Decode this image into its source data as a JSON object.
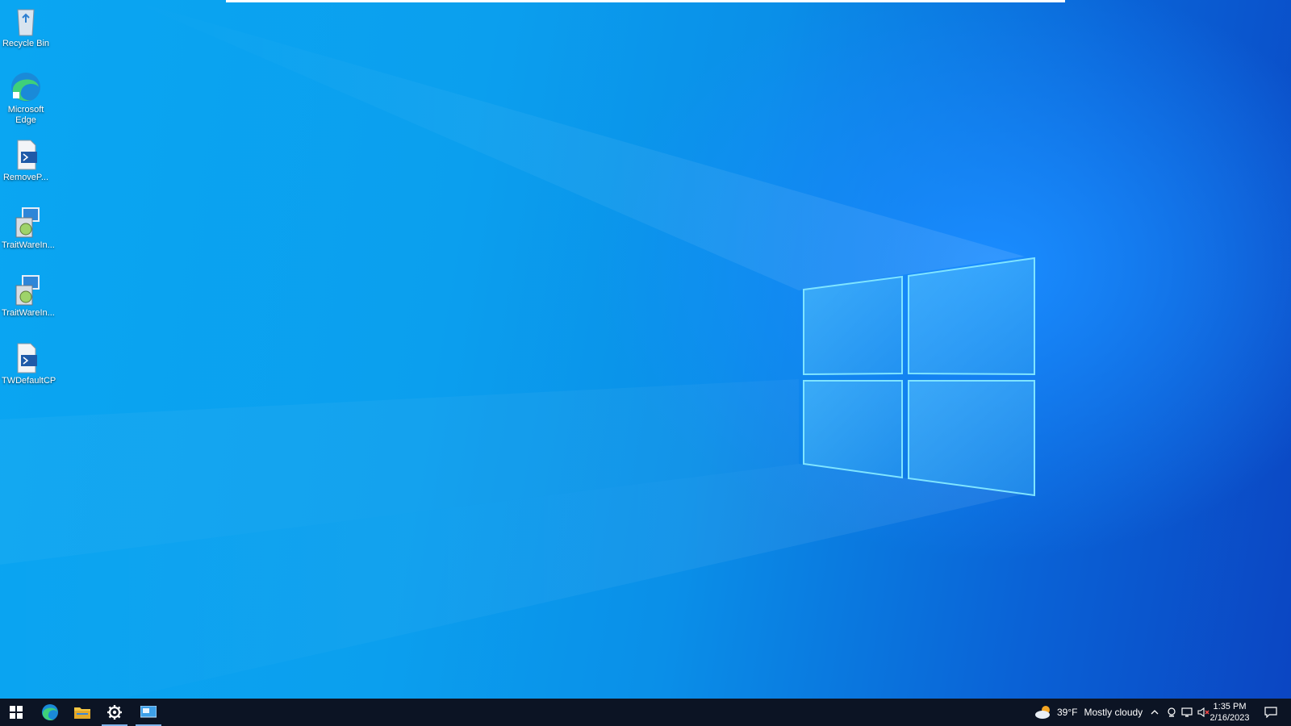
{
  "desktop": {
    "icons": [
      {
        "label": "Recycle Bin",
        "icon": "recycle-bin-icon"
      },
      {
        "label": "Microsoft Edge",
        "icon": "edge-icon"
      },
      {
        "label": "RemoveP...",
        "icon": "powershell-script-icon"
      },
      {
        "label": "TraitWareIn...",
        "icon": "installer-icon"
      },
      {
        "label": "TraitWareIn...",
        "icon": "installer-icon"
      },
      {
        "label": "TWDefaultCP",
        "icon": "powershell-script-icon"
      }
    ]
  },
  "taskbar": {
    "weather": {
      "temp": "39°F",
      "condition": "Mostly cloudy"
    },
    "clock": {
      "time": "1:35 PM",
      "date": "2/16/2023"
    },
    "pinned": [
      "start-icon",
      "edge-icon",
      "file-explorer-icon",
      "settings-icon",
      "remote-desktop-icon"
    ],
    "accent_color": "#7fb2e8"
  }
}
